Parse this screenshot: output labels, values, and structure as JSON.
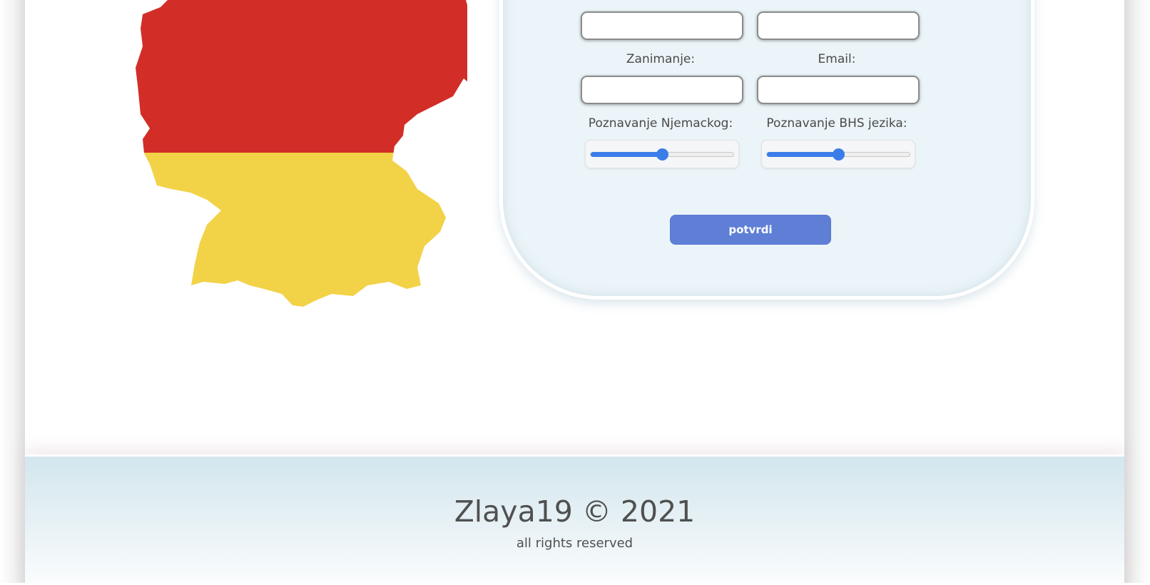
{
  "map": {
    "icon": "germany-flag-map",
    "colors": {
      "top": "#d22e27",
      "bottom": "#f2d247"
    }
  },
  "form": {
    "fields": {
      "zanimanje_label": "Zanimanje:",
      "email_label": "Email:",
      "german_label": "Poznavanje Njemackog:",
      "bhs_label": "Poznavanje BHS jezika:",
      "first_value": "",
      "second_value": "",
      "zanimanje_value": "",
      "email_value": ""
    },
    "sliders": {
      "german_level": 0.5,
      "bhs_level": 0.5
    },
    "submit_label": "potvrdi",
    "accent_color": "#3b7de8",
    "button_color": "#5f7fd6"
  },
  "footer": {
    "title": "Zlaya19 © 2021",
    "subtitle": "all rights reserved"
  }
}
